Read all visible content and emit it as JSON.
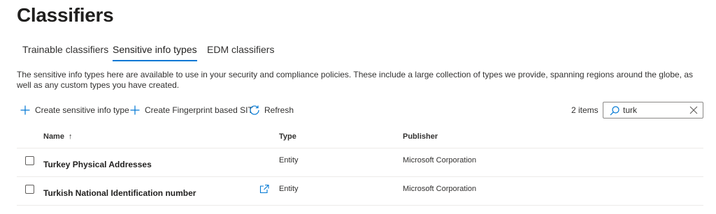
{
  "page": {
    "title": "Classifiers"
  },
  "tabs": [
    {
      "label": "Trainable classifiers",
      "active": false
    },
    {
      "label": "Sensitive info types",
      "active": true
    },
    {
      "label": "EDM classifiers",
      "active": false
    }
  ],
  "description": "The sensitive info types here are available to use in your security and compliance policies. These include a large collection of types we provide, spanning regions around the globe, as well as any custom types you have created.",
  "toolbar": {
    "create_label": "Create sensitive info type",
    "fingerprint_label": "Create Fingerprint based SIT",
    "refresh_label": "Refresh",
    "count": "2 items",
    "search_value": "turk",
    "icons": {
      "create": "plus-icon",
      "fingerprint": "plus-icon",
      "refresh": "refresh-icon",
      "search": "search-icon",
      "clear": "close-icon"
    }
  },
  "table": {
    "headers": {
      "name": "Name",
      "sort": "↑",
      "type": "Type",
      "publisher": "Publisher"
    },
    "rows": [
      {
        "name": "Turkey Physical Addresses",
        "type": "Entity",
        "publisher": "Microsoft Corporation",
        "open_icon": false
      },
      {
        "name": "Turkish National Identification number",
        "type": "Entity",
        "publisher": "Microsoft Corporation",
        "open_icon": true
      }
    ]
  },
  "colors": {
    "accent": "#0078d4",
    "text": "#323130",
    "divider": "#edebe9"
  }
}
